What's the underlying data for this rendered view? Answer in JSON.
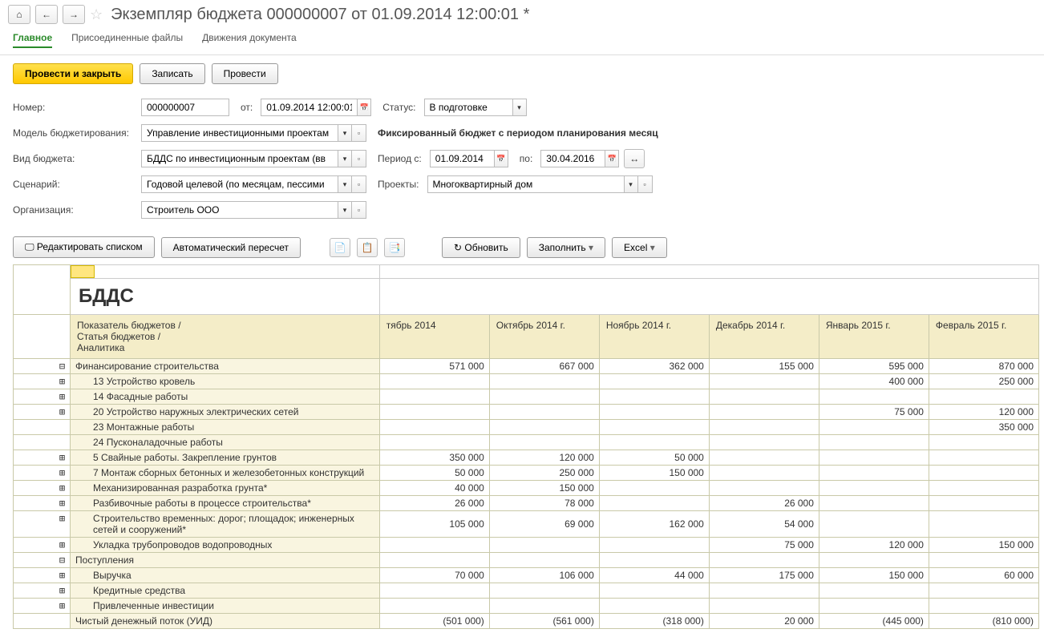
{
  "title": "Экземпляр бюджета 000000007 от 01.09.2014 12:00:01 *",
  "tabs": {
    "main": "Главное",
    "files": "Присоединенные файлы",
    "moves": "Движения документа"
  },
  "buttons": {
    "post_close": "Провести и закрыть",
    "save": "Записать",
    "post": "Провести",
    "edit_list": "Редактировать списком",
    "auto_recalc": "Автоматический пересчет",
    "refresh": "Обновить",
    "fill": "Заполнить",
    "excel": "Excel"
  },
  "labels": {
    "number": "Номер:",
    "from": "от:",
    "status": "Статус:",
    "model": "Модель бюджетирования:",
    "fixed": "Фиксированный бюджет с периодом планирования месяц",
    "budget_type": "Вид бюджета:",
    "period_from": "Период с:",
    "to": "по:",
    "scenario": "Сценарий:",
    "projects": "Проекты:",
    "org": "Организация:"
  },
  "values": {
    "number": "000000007",
    "date": "01.09.2014 12:00:01",
    "status": "В подготовке",
    "model": "Управление инвестиционными проектам",
    "budget_type": "БДДС по инвестиционным проектам (вв",
    "period_from": "01.09.2014",
    "period_to": "30.04.2016",
    "scenario": "Годовой целевой (по месяцам, пессими",
    "projects": "Многоквартирный дом",
    "org": "Строитель ООО"
  },
  "grid": {
    "title": "БДДС",
    "header_label": "Показатель бюджетов /\nСтатья бюджетов /\nАналитика",
    "columns": [
      "тябрь 2014",
      "Октябрь 2014 г.",
      "Ноябрь 2014 г.",
      "Декабрь 2014 г.",
      "Январь 2015 г.",
      "Февраль 2015 г."
    ],
    "rows": [
      {
        "level": 1,
        "tree": "⊟",
        "label": "Финансирование строительства",
        "vals": [
          "571 000",
          "667 000",
          "362 000",
          "155 000",
          "595 000",
          "870 000"
        ]
      },
      {
        "level": 2,
        "tree": "⊞",
        "label": "13 Устройство кровель",
        "vals": [
          "",
          "",
          "",
          "",
          "400 000",
          "250 000"
        ]
      },
      {
        "level": 2,
        "tree": "⊞",
        "label": "14 Фасадные работы",
        "vals": [
          "",
          "",
          "",
          "",
          "",
          ""
        ]
      },
      {
        "level": 2,
        "tree": "⊞",
        "label": "20 Устройство наружных электрических сетей",
        "vals": [
          "",
          "",
          "",
          "",
          "75 000",
          "120 000"
        ]
      },
      {
        "level": 2,
        "tree": "",
        "label": "23 Монтажные работы",
        "vals": [
          "",
          "",
          "",
          "",
          "",
          "350 000"
        ]
      },
      {
        "level": 2,
        "tree": "",
        "label": "24 Пусконаладочные работы",
        "vals": [
          "",
          "",
          "",
          "",
          "",
          ""
        ]
      },
      {
        "level": 2,
        "tree": "⊞",
        "label": "5 Свайные работы. Закрепление грунтов",
        "vals": [
          "350 000",
          "120 000",
          "50 000",
          "",
          "",
          ""
        ]
      },
      {
        "level": 2,
        "tree": "⊞",
        "label": "7 Монтаж сборных бетонных и железобетонных конструкций",
        "vals": [
          "50 000",
          "250 000",
          "150 000",
          "",
          "",
          ""
        ]
      },
      {
        "level": 2,
        "tree": "⊞",
        "label": "Механизированная разработка грунта*",
        "vals": [
          "40 000",
          "150 000",
          "",
          "",
          "",
          ""
        ]
      },
      {
        "level": 2,
        "tree": "⊞",
        "label": "Разбивочные работы в процессе строительства*",
        "vals": [
          "26 000",
          "78 000",
          "",
          "26 000",
          "",
          ""
        ]
      },
      {
        "level": 2,
        "tree": "⊞",
        "label": "Строительство временных: дорог; площадок; инженерных сетей и сооружений*",
        "vals": [
          "105 000",
          "69 000",
          "162 000",
          "54 000",
          "",
          ""
        ]
      },
      {
        "level": 2,
        "tree": "⊞",
        "label": "Укладка трубопроводов водопроводных",
        "vals": [
          "",
          "",
          "",
          "75 000",
          "120 000",
          "150 000"
        ]
      },
      {
        "level": 1,
        "tree": "⊟",
        "label": "Поступления",
        "vals": [
          "",
          "",
          "",
          "",
          "",
          ""
        ]
      },
      {
        "level": 2,
        "tree": "⊞",
        "label": "Выручка",
        "vals": [
          "70 000",
          "106 000",
          "44 000",
          "175 000",
          "150 000",
          "60 000"
        ]
      },
      {
        "level": 2,
        "tree": "⊞",
        "label": "Кредитные средства",
        "vals": [
          "",
          "",
          "",
          "",
          "",
          ""
        ]
      },
      {
        "level": 2,
        "tree": "⊞",
        "label": "Привлеченные инвестиции",
        "vals": [
          "",
          "",
          "",
          "",
          "",
          ""
        ]
      },
      {
        "level": 1,
        "tree": "",
        "label": "Чистый денежный поток (УИД)",
        "vals": [
          "(501 000)",
          "(561 000)",
          "(318 000)",
          "20 000",
          "(445 000)",
          "(810 000)"
        ]
      }
    ]
  }
}
